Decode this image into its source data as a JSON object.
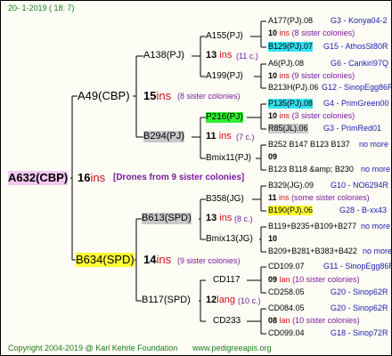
{
  "header": {
    "date": "20-   1-2019  ( 18:   7)"
  },
  "root": {
    "label": "A632(CBP)",
    "ins": "16",
    "ins_word": "ins",
    "note": "[Drones from 9 sister colonies]"
  },
  "gen1": {
    "top": {
      "label": "A49(CBP)",
      "ins": "15",
      "ins_word": "ins",
      "note": "(8 sister colonies)"
    },
    "bottom": {
      "label": "B634(SPD)",
      "ins": "14",
      "ins_word": "ins",
      "note": "(9 sister colonies)"
    }
  },
  "gen2": {
    "a138": {
      "label": "A138(PJ)",
      "ins": "13",
      "ins_word": "ins",
      "note": "(11 c.)"
    },
    "b294": {
      "label": "B294(PJ)",
      "ins": "11",
      "ins_word": "ins",
      "note": "(7 c.)"
    },
    "b613": {
      "label": "B613(SPD)",
      "ins": "13",
      "ins_word": "ins",
      "note": "(8 c.)"
    },
    "b117": {
      "label": "B117(SPD)",
      "ins": "12",
      "ins_word": "lang",
      "note": "(10 c.)"
    }
  },
  "gen3": {
    "a155": "A155(PJ)",
    "a199": "A199(PJ)",
    "p216": "P216(PJ)",
    "bmix11": "Bmix11(PJ)",
    "b358": "B358(JG)",
    "bmix13": "Bmix13(JG)",
    "cd117": "CD117",
    "cd233": "CD233"
  },
  "gen4": [
    {
      "label": "A177(PJ).08",
      "group": "G3 - Konya04-2"
    },
    {
      "count": "10",
      "ins_word": "ins",
      "note": "(8 sister colonies)"
    },
    {
      "label": "B129(PJ).07",
      "group": "G15 - AthosSt80R"
    },
    {
      "label": "A6(PJ).08",
      "group": "G6 - Cankiri97Q"
    },
    {
      "count": "10",
      "ins_word": "ins",
      "note": "(9 sister colonies)"
    },
    {
      "label": "B213H(PJ).06",
      "group": "G12 - SinopEgg86R"
    },
    {
      "label": "P135(PJ).08",
      "group": "G4 - PrimGreen00"
    },
    {
      "count": "10",
      "ins_word": "ins",
      "note": "(3 sister colonies)"
    },
    {
      "label": "R85(JL).06",
      "group": "G3 - PrimRed01"
    },
    {
      "label": "B252 B147 B123 B137",
      "more": "no more"
    },
    {
      "count": "09"
    },
    {
      "label": "B123 B118 &amp; B230",
      "more": "no more"
    },
    {
      "label": "B329(JG).09",
      "group": "G10 - NO6294R"
    },
    {
      "count": "11",
      "ins_word": "ins",
      "note": "(some sister colonies)"
    },
    {
      "label": "B190(PJ).06",
      "group": "G28 - B-xx43"
    },
    {
      "label": "B119+B235+B109+B277",
      "more": "no more"
    },
    {
      "count": "10"
    },
    {
      "label": "B209+B281+B383+B422",
      "more": "no more"
    },
    {
      "label": "CD109.07",
      "group": "G11 - SinopEgg86R"
    },
    {
      "count": "09",
      "ins_word": "lan",
      "note": "(10 sister colonies)"
    },
    {
      "label": "CD258.05",
      "group": "G20 - Sinop62R"
    },
    {
      "label": "CD084.05",
      "group": "G20 - Sinop62R"
    },
    {
      "count": "08",
      "ins_word": "lan",
      "note": "(10 sister colonies)"
    },
    {
      "label": "CD099.04",
      "group": "G18 - Sinop72R"
    }
  ],
  "footer": {
    "copyright": "Copyright 2004-2019 @ Karl Kehrle Foundation",
    "site": "www.pedigreeapis.org"
  }
}
